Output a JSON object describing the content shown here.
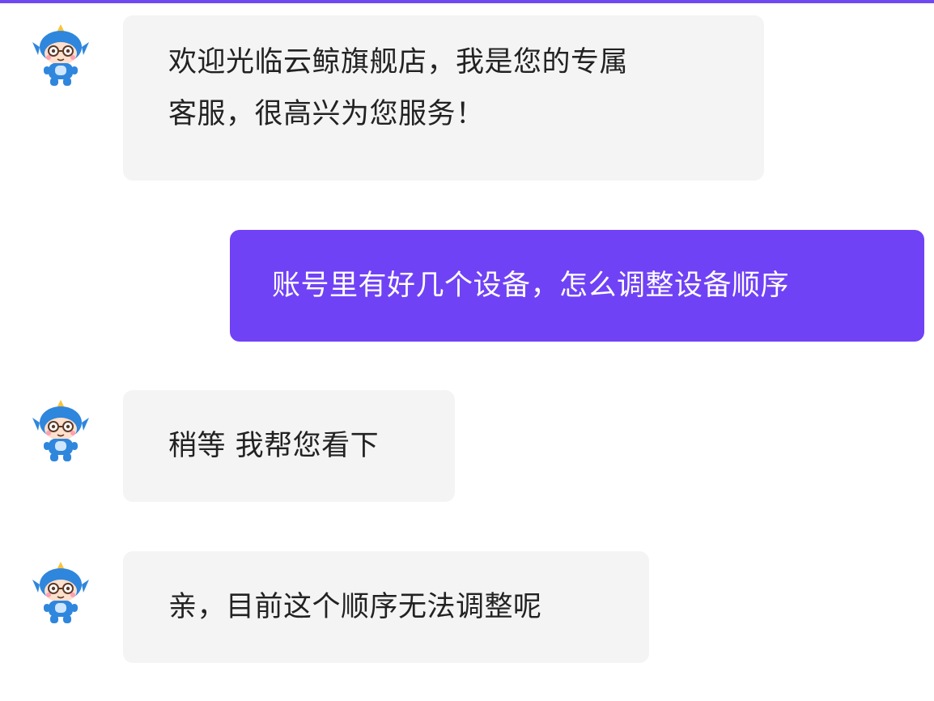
{
  "theme": {
    "accent": "#7048f2",
    "user_bubble": "#7042f5",
    "agent_bubble": "#f4f4f4",
    "agent_text": "#222222",
    "user_text": "#ffffff"
  },
  "messages": [
    {
      "sender": "agent",
      "avatar_icon": "blue-dragon-mascot-icon",
      "lines": [
        "欢迎光临云鲸旗舰店，我是您的专属",
        "客服，很高兴为您服务！"
      ]
    },
    {
      "sender": "user",
      "lines": [
        "账号里有好几个设备，怎么调整设备顺序"
      ]
    },
    {
      "sender": "agent",
      "avatar_icon": "blue-dragon-mascot-icon",
      "lines": [
        "稍等 我帮您看下"
      ]
    },
    {
      "sender": "agent",
      "avatar_icon": "blue-dragon-mascot-icon",
      "lines": [
        "亲，目前这个顺序无法调整呢"
      ]
    }
  ]
}
